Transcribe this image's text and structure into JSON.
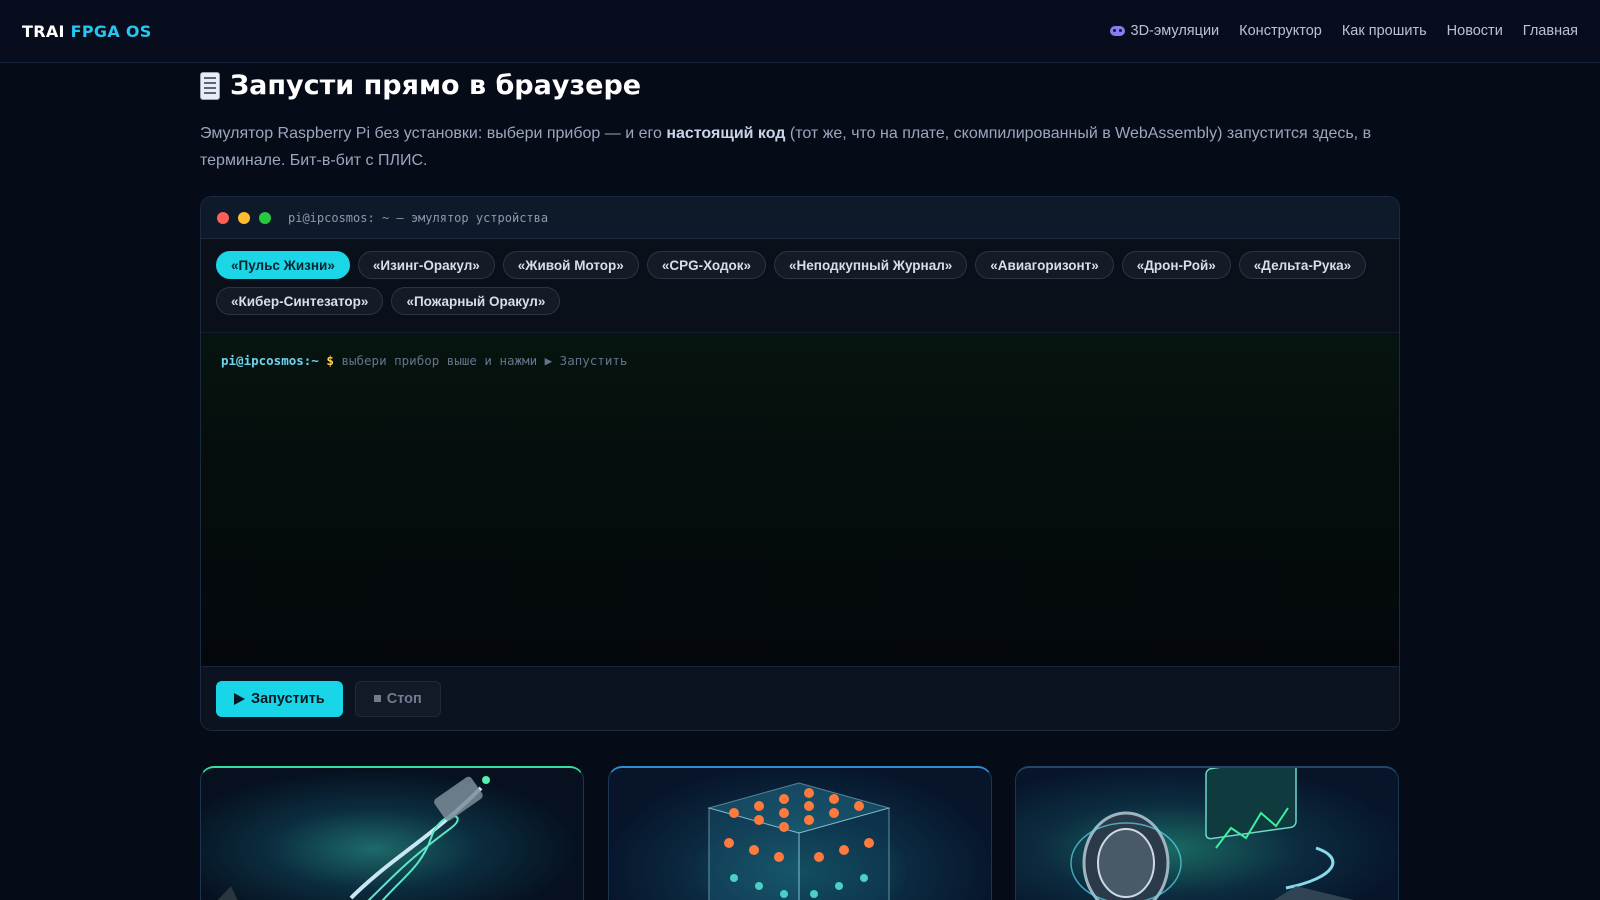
{
  "header": {
    "logo_part1": "TRAI",
    "logo_part2": "FPGA OS",
    "nav": [
      {
        "label": "3D-эмуляции",
        "icon": "gamepad-icon"
      },
      {
        "label": "Конструктор"
      },
      {
        "label": "Как прошить"
      },
      {
        "label": "Новости"
      },
      {
        "label": "Главная"
      }
    ]
  },
  "section": {
    "icon": "document-icon",
    "title": "Запусти прямо в браузере",
    "desc_part1": "Эмулятор Raspberry Pi без установки: выбери прибор — и его ",
    "desc_bold": "настоящий код",
    "desc_part2": " (тот же, что на плате, скомпилированный в WebAssembly) запустится здесь, в терминале. Бит-в-бит с ПЛИС."
  },
  "terminal": {
    "title": "pi@ipcosmos: ~ — эмулятор устройства",
    "devices": [
      {
        "label": "«Пульс Жизни»",
        "active": true
      },
      {
        "label": "«Изинг-Оракул»"
      },
      {
        "label": "«Живой Мотор»"
      },
      {
        "label": "«CPG-Ходок»"
      },
      {
        "label": "«Неподкупный Журнал»"
      },
      {
        "label": "«Авиагоризонт»"
      },
      {
        "label": "«Дрон-Рой»"
      },
      {
        "label": "«Дельта-Рука»"
      },
      {
        "label": "«Кибер-Синтезатор»"
      },
      {
        "label": "«Пожарный Оракул»"
      }
    ],
    "prompt_user": "pi@ipcosmos:~",
    "prompt_sign": "$",
    "prompt_hint": "выбери прибор выше и нажми ▶ Запустить",
    "run_label": "Запустить",
    "stop_label": "Стоп"
  },
  "colors": {
    "accent": "#1bd6e6",
    "background": "#060b18"
  }
}
